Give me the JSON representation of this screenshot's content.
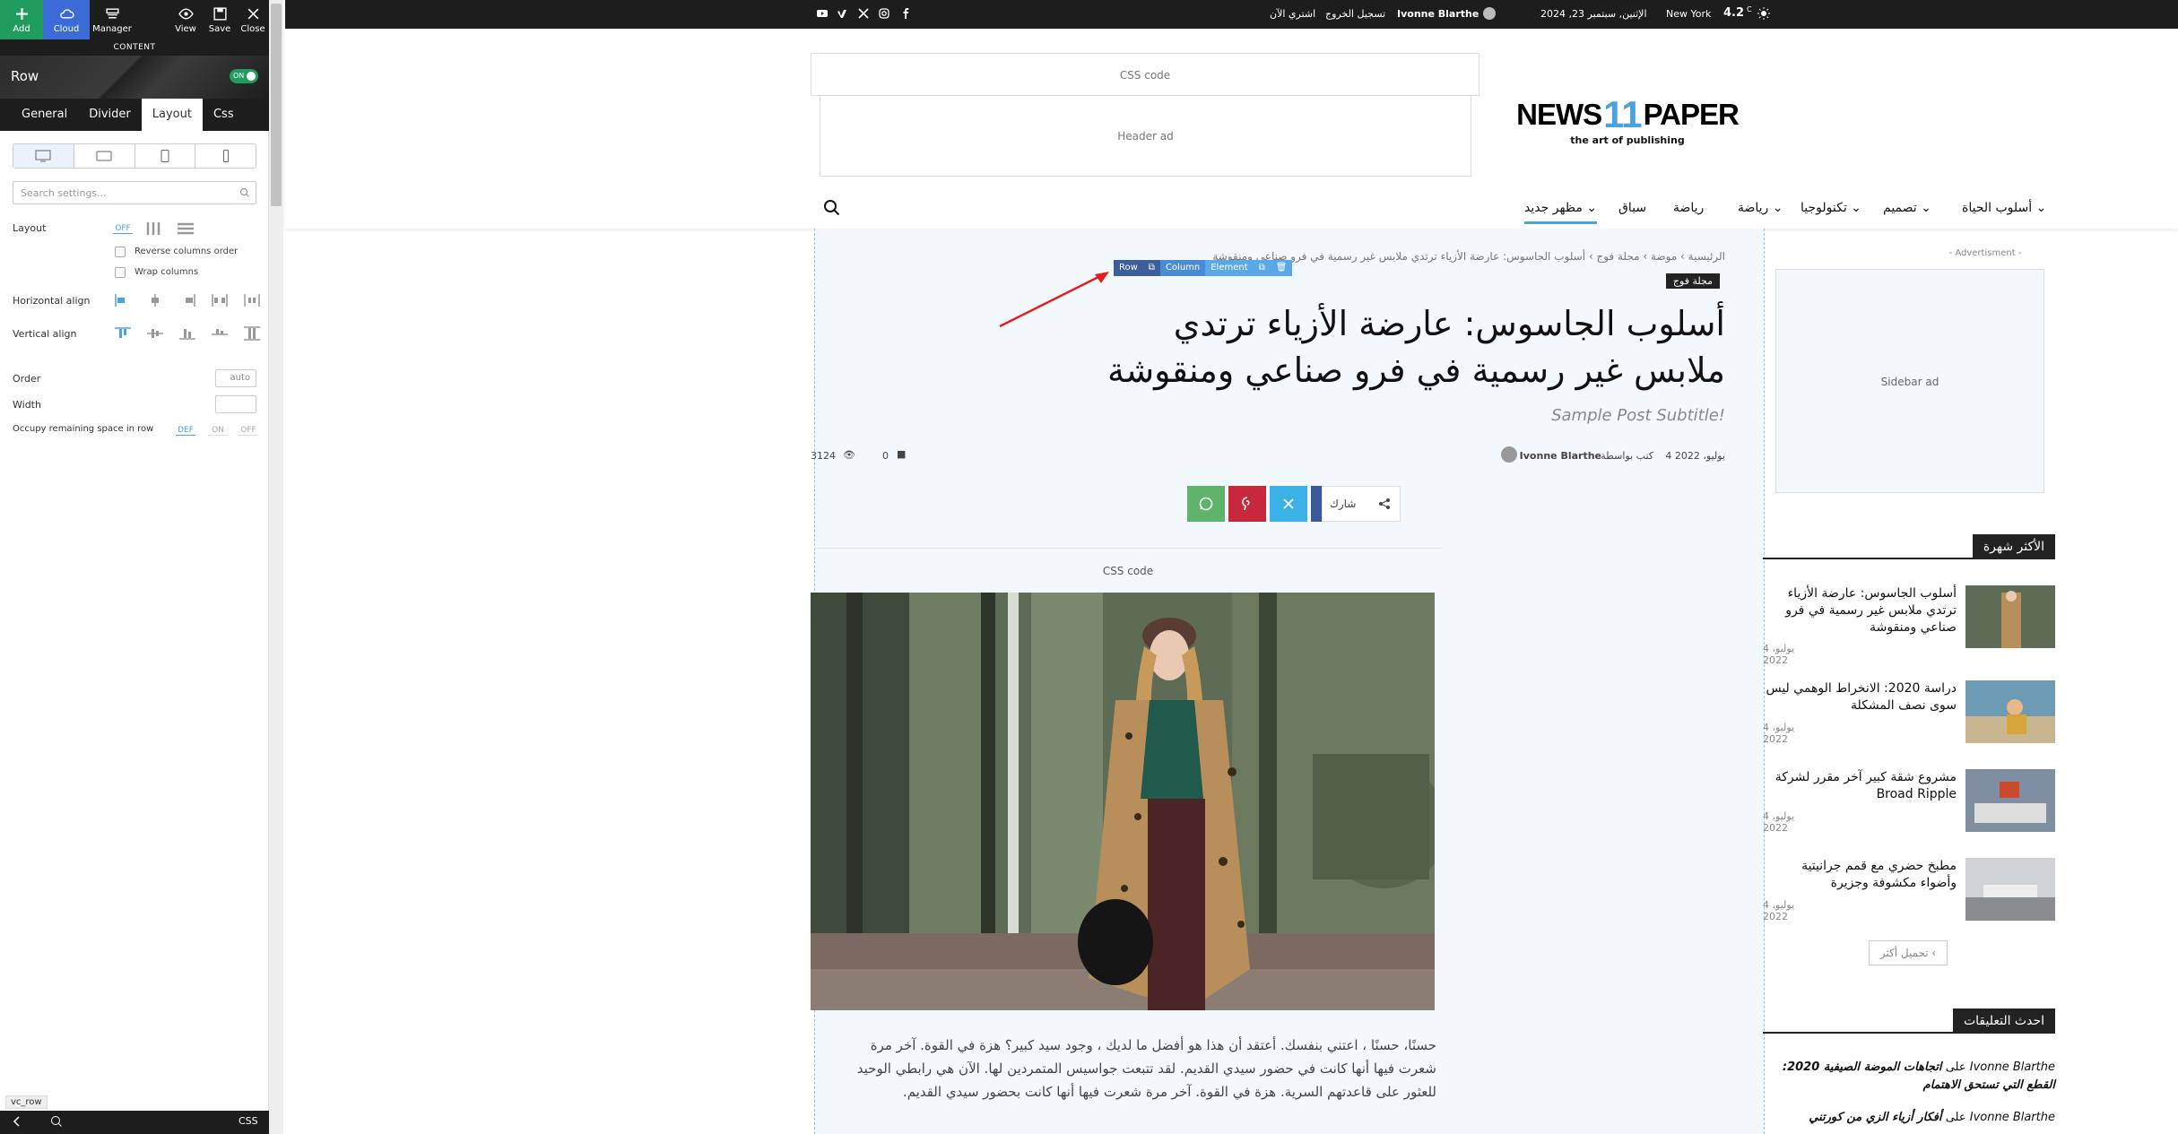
{
  "editor": {
    "toolbar": {
      "add": "Add",
      "cloud": "Cloud",
      "manager": "Manager",
      "view": "View",
      "save": "Save",
      "close": "Close"
    },
    "section_label": "CONTENT",
    "element_title": "Row",
    "toggle": "ON",
    "tabs": [
      "General",
      "Divider",
      "Layout",
      "Css"
    ],
    "active_tab": "Layout",
    "search_placeholder": "Search settings...",
    "layout_label": "Layout",
    "layout_off": "OFF",
    "reverse_columns": "Reverse columns order",
    "wrap_columns": "Wrap columns",
    "horizontal_align": "Horizontal align",
    "vertical_align": "Vertical align",
    "order_label": "Order",
    "order_value": "auto",
    "width_label": "Width",
    "occupy_label": "Occupy remaining space in row",
    "occupy_options": [
      "DEF",
      "ON",
      "OFF"
    ],
    "status_tag": "vc_row",
    "bottom_css": "CSS"
  },
  "site": {
    "topbar": {
      "weather_temp": "4.2",
      "weather_unit": "C",
      "city": "New York",
      "date": "الإثنين, سبتمبر 23, 2024",
      "user": "Ivonne Blarthe",
      "logout": "تسجيل الخروج",
      "buy": "اشتري الآن"
    },
    "css_code_label": "CSS code",
    "header_ad": "Header ad",
    "logo": {
      "pre": "NEWS",
      "num": "11",
      "post": "PAPER",
      "tagline": "the art of publishing"
    },
    "nav": [
      "أسلوب الحياة",
      "تكنولوجيا",
      "تصميم",
      "رياضة",
      "رياضة",
      "سباق",
      "مظهر جديد"
    ],
    "nav_active": "مظهر جديد",
    "breadcrumbs": "الرئيسية › موضة › مجلة فوج › أسلوب الجاسوس: عارضة الأزياء ترتدي ملابس غير رسمية في فرو صناعي ومنقوشة",
    "builder_toolbar": [
      "Row",
      "Column",
      "Element"
    ],
    "category": "مجلة فوج",
    "title": "أسلوب الجاسوس: عارضة الأزياء ترتدي ملابس غير رسمية في فرو صناعي ومنقوشة",
    "subtitle": "Sample Post Subtitle!",
    "meta": {
      "by": "كتب بواسطة",
      "author": "Ivonne Blarthe",
      "date": "4 يوليو، 2022",
      "comments": "0",
      "views": "3124"
    },
    "share_label": "شارك",
    "css_code_inner": "CSS code",
    "body_text": "حسنًا، حسنًا ، اعتني بنفسك. أعتقد أن هذا هو أفضل ما لديك ، وجود سيد كبير؟ هزة في القوة. آخر مرة شعرت فيها أنها كانت في حضور سيدي القديم. لقد تتبعت جواسيس المتمردين لها. الآن هي رابطي الوحيد للعثور على قاعدتهم السرية. هزة في القوة. آخر مرة شعرت فيها أنها كانت بحضور سيدي القديم.",
    "sidebar": {
      "advert_label": "- Advertisment -",
      "sidebar_ad": "Sidebar ad",
      "popular_heading": "الأكثر شهرة",
      "popular": [
        {
          "title": "أسلوب الجاسوس: عارضة الأزياء ترتدي ملابس غير رسمية في فرو صناعي ومنقوشة",
          "date": "4 يوليو، 2022"
        },
        {
          "title": "دراسة 2020: الانخراط الوهمي ليس سوى نصف المشكلة",
          "date": "4 يوليو، 2022"
        },
        {
          "title": "مشروع شقة كبير آخر مقرر لشركة Broad Ripple",
          "date": "4 يوليو، 2022"
        },
        {
          "title": "مطبخ حضري مع قمم جرانيتية وأضواء مكشوفة وجزيرة",
          "date": "4 يوليو، 2022"
        }
      ],
      "load_more": "تحميل أكثر",
      "comments_heading": "احدث التعليقات",
      "comments": [
        {
          "user": "Ivonne Blarthe",
          "on": "على",
          "title": "اتجاهات الموضة الصيفية 2020: القطع التي تستحق الاهتمام"
        },
        {
          "user": "Ivonne Blarthe",
          "on": "على",
          "title": "أفكار أزياء الزي من كورتني"
        }
      ]
    }
  },
  "colors": {
    "accent": "#4aa3df",
    "add_green": "#1f9d5f",
    "cloud_blue": "#3a6bd6",
    "dark": "#1d1d1d",
    "arrow": "#e02020"
  }
}
